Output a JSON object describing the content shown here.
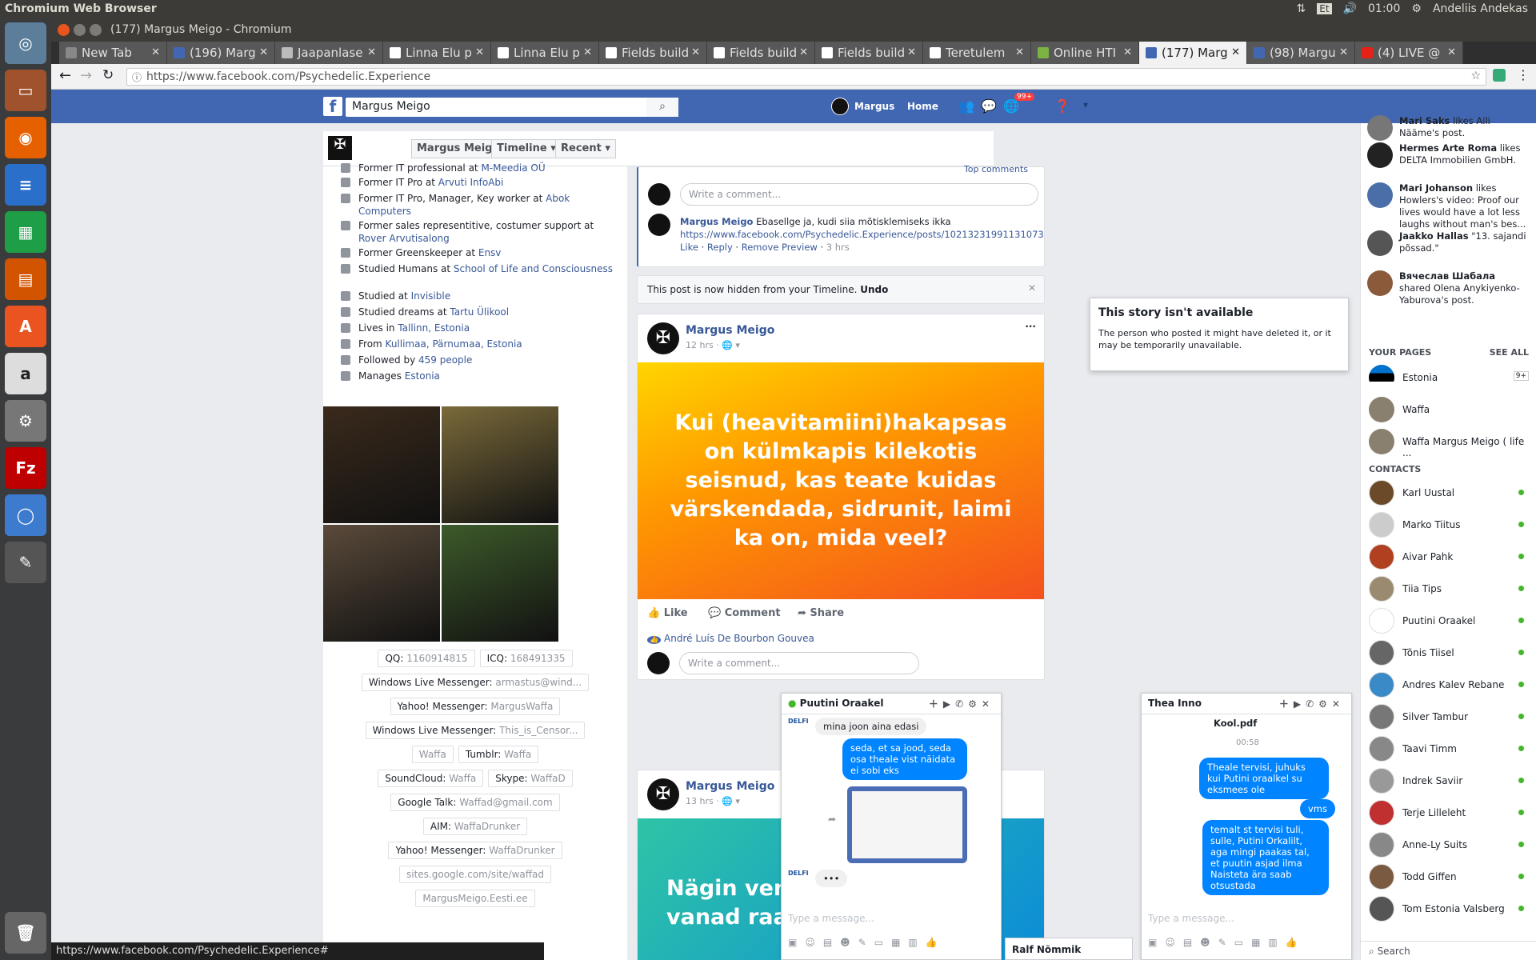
{
  "system": {
    "app_title": "Chromium Web Browser",
    "time": "01:00",
    "user": "Andeliis Andekas",
    "lang": "Et"
  },
  "window": {
    "title": "(177) Margus Meigo - Chromium"
  },
  "tabs": [
    {
      "label": "New Tab",
      "color": "#888"
    },
    {
      "label": "(196) Marg",
      "color": "#4267b2"
    },
    {
      "label": "Jaapanlase",
      "color": "#bbb"
    },
    {
      "label": "Linna Elu p",
      "color": "#fff"
    },
    {
      "label": "Linna Elu p",
      "color": "#fff"
    },
    {
      "label": "Fields build",
      "color": "#fff"
    },
    {
      "label": "Fields build",
      "color": "#fff"
    },
    {
      "label": "Fields build",
      "color": "#fff"
    },
    {
      "label": "Teretulem",
      "color": "#fff"
    },
    {
      "label": "Online HTI",
      "color": "#7cb342"
    },
    {
      "label": "(177) Marg",
      "color": "#4267b2",
      "active": true
    },
    {
      "label": "(98) Margu",
      "color": "#4267b2"
    },
    {
      "label": "(4) LIVE @",
      "color": "#e62117"
    }
  ],
  "address": {
    "url": "https://www.facebook.com/Psychedelic.Experience"
  },
  "fb": {
    "search_value": "Margus Meigo",
    "user_name": "Margus",
    "home": "Home",
    "notif_count": "99+",
    "profile_header": {
      "name": "Margus Meigo",
      "timeline": "Timeline",
      "recent": "Recent"
    },
    "intro": [
      {
        "text": "Former IT professional at ",
        "link": "M-Meedia OÜ"
      },
      {
        "text": "Former IT Pro at ",
        "link": "Arvuti InfoAbi"
      },
      {
        "text": "Former IT Pro, Manager, Key worker at ",
        "link": "Abok Computers"
      },
      {
        "text": "Former sales representitive, costumer support at ",
        "link": "Rover Arvutisalong"
      },
      {
        "text": "Former Greenskeeper at ",
        "link": "Ensv"
      },
      {
        "text": "Studied Humans at ",
        "link": "School of Life and Consciousness"
      },
      {
        "text": "Studied at ",
        "link": "Invisible"
      },
      {
        "text": "Studied dreams at ",
        "link": "Tartu Ülikool"
      },
      {
        "text": "Lives in ",
        "link": "Tallinn, Estonia"
      },
      {
        "text": "From ",
        "link": "Kullimaa, Pärnumaa, Estonia"
      },
      {
        "text": "Followed by ",
        "link": "459 people"
      },
      {
        "text": "Manages ",
        "link": "Estonia"
      }
    ],
    "contact_chips": [
      {
        "k": "QQ:",
        "v": "1160914815"
      },
      {
        "k": "ICQ:",
        "v": "168491335"
      },
      {
        "k": "Windows Live Messenger:",
        "v": "armastus@wind..."
      },
      {
        "k": "Yahoo! Messenger:",
        "v": "MargusWaffa"
      },
      {
        "k": "Windows Live Messenger:",
        "v": "This_is_Censor..."
      },
      {
        "k": "",
        "v": "Waffa"
      },
      {
        "k": "Tumblr:",
        "v": "Waffa"
      },
      {
        "k": "SoundCloud:",
        "v": "Waffa"
      },
      {
        "k": "Skype:",
        "v": "WaffaD"
      },
      {
        "k": "Google Talk:",
        "v": "Waffad@gmail.com"
      },
      {
        "k": "AIM:",
        "v": "WaffaDrunker"
      },
      {
        "k": "Yahoo! Messenger:",
        "v": "WaffaDrunker"
      },
      {
        "k": "",
        "v": "sites.google.com/site/waffad"
      },
      {
        "k": "",
        "v": "MargusMeigo.Eesti.ee"
      }
    ],
    "comment_box": {
      "placeholder": "Write a comment...",
      "top_comments": "Top comments"
    },
    "comment": {
      "author": "Margus Meigo",
      "text": "Ebasellge ja, kudi siia mõtisklemiseks ikka",
      "link": "https://www.facebook.com/Psychedelic.Experience/posts/10213231991131073",
      "like": "Like",
      "reply": "Reply",
      "remove": "Remove Preview",
      "time": "3 hrs"
    },
    "hidden_notice": {
      "text": "This post is now hidden from your Timeline.",
      "undo": "Undo"
    },
    "post1": {
      "author": "Margus Meigo",
      "time": "12 hrs",
      "text": "Kui (heavitamiini)hakapsas on külmkapis kilekotis seisnud, kas teate kuidas värskendada, sidrunit, laimi ka on, mida veel?",
      "like": "Like",
      "comment": "Comment",
      "share": "Share",
      "liker": "André Luís De Bourbon Gouvea"
    },
    "post2": {
      "author": "Margus Meigo",
      "time": "13 hrs",
      "text": "Nägin venna n und, et vanad raadiod (m"
    },
    "story": {
      "title": "This story isn't available",
      "body": "The person who posted it might have deleted it, or it may be temporarily unavailable."
    },
    "ticker": [
      {
        "name": "Mari Saks",
        "rest": " likes Aili Nääme's post."
      },
      {
        "name": "Hermes Arte Roma",
        "rest": " likes DELTA Immobilien GmbH."
      },
      {
        "name": "Mari Johanson",
        "rest": " likes Howlers's video: Proof our lives would have a lot less laughs without man's bes..."
      },
      {
        "name": "Jaakko Hallas",
        "rest": " \"13. sajandi põssad.\""
      },
      {
        "name": "Вячеслав Шабала",
        "rest": " shared Olena Anykiyenko-Yaburova's post."
      }
    ],
    "your_pages": {
      "label": "YOUR PAGES",
      "see_all": "SEE ALL",
      "items": [
        "Estonia",
        "Waffa",
        "Waffa Margus Meigo ( life ..."
      ],
      "badge": "9+"
    },
    "contacts": {
      "label": "CONTACTS",
      "items": [
        "Karl Uustal",
        "Marko Tiitus",
        "Aivar Pahk",
        "Tiia Tips",
        "Puutini Oraakel",
        "Tõnis Tiisel",
        "Andres Kalev Rebane",
        "Silver Tambur",
        "Taavi Timm",
        "Indrek Saviir",
        "Terje Lilleleht",
        "Anne-Ly Suits",
        "Todd Giffen",
        "Tom Estonia Valsberg"
      ]
    },
    "search_bottom": "Search",
    "chat1": {
      "title": "Puutini Oraakel",
      "m1": "mina joon aina edasi",
      "m2": "seda, et sa jood, seda osa theale vist näidata ei sobi eks",
      "placeholder": "Type a message..."
    },
    "chat2": {
      "title": "Thea Inno",
      "file": "Kool.pdf",
      "time": "00:58",
      "m1": "Theale tervisi, juhuks kui Putini oraalkel su eksmees ole",
      "m2": "vms",
      "m3": "temalt st tervisi tuli, sulle, Putini Orkalilt, aga mingi paakas tal, et puutin asjad ilma Naisteta ära saab otsustada",
      "placeholder": "Type a message..."
    },
    "mini_chat": "Ralf Nõmmik",
    "status_url": "https://www.facebook.com/Psychedelic.Experience#"
  },
  "colors": {
    "fb_blue": "#4267b2",
    "link": "#385898",
    "bubble": "#0084ff"
  }
}
